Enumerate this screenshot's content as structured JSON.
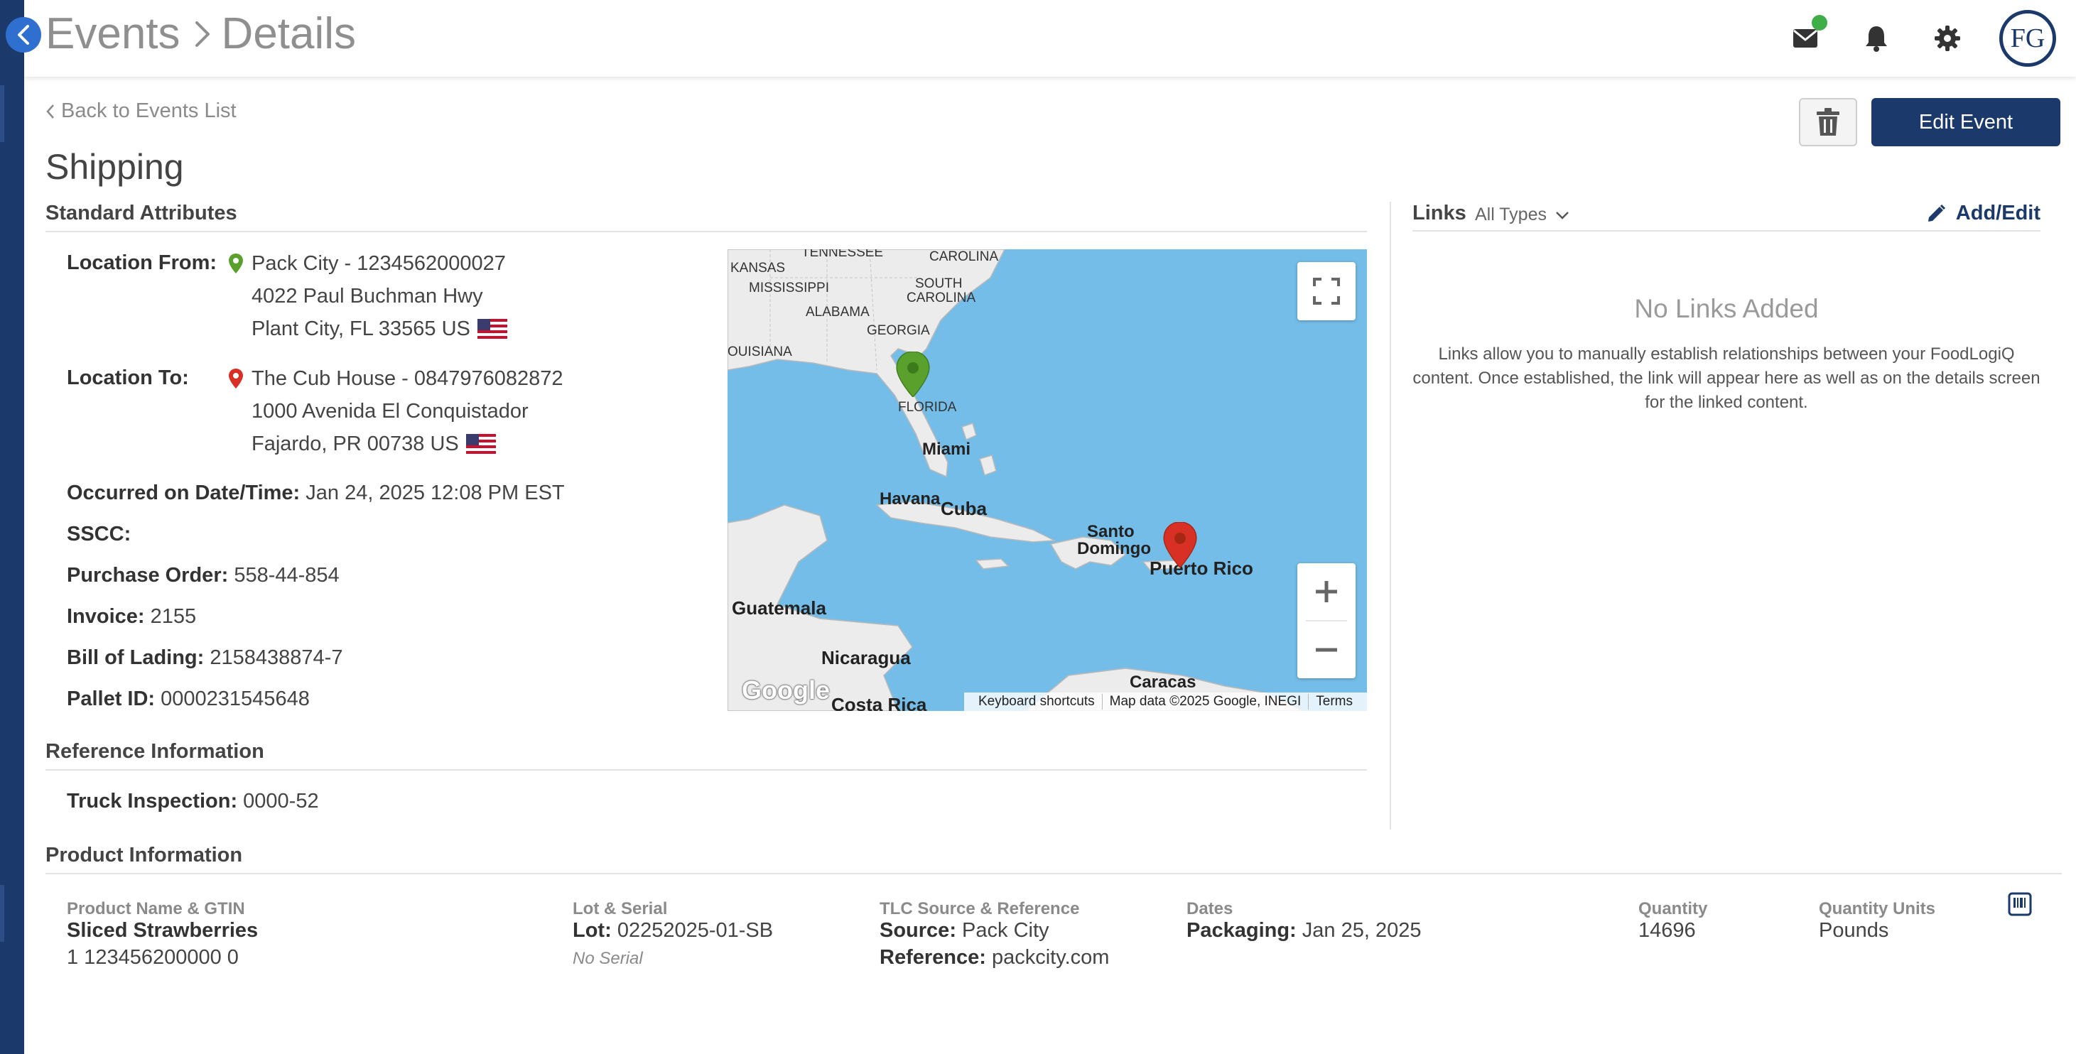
{
  "header": {
    "breadcrumb": [
      "Events",
      "Details"
    ],
    "avatar_text": "FG"
  },
  "actions": {
    "back_label": "Back to Events List",
    "edit_label": "Edit Event"
  },
  "page": {
    "title": "Shipping"
  },
  "standard_attributes": {
    "heading": "Standard Attributes",
    "location_from": {
      "label": "Location From:",
      "line1": "Pack City - 1234562000027",
      "line2": "4022 Paul Buchman Hwy",
      "line3": "Plant City, FL 33565 US"
    },
    "location_to": {
      "label": "Location To:",
      "line1": "The Cub House - 0847976082872",
      "line2": "1000 Avenida El Conquistador",
      "line3": "Fajardo, PR 00738 US"
    },
    "occurred": {
      "label": "Occurred on Date/Time:",
      "value": "Jan 24, 2025 12:08 PM EST"
    },
    "sscc": {
      "label": "SSCC:",
      "value": ""
    },
    "purchase_order": {
      "label": "Purchase Order:",
      "value": "558-44-854"
    },
    "invoice": {
      "label": "Invoice:",
      "value": "2155"
    },
    "bill_of_lading": {
      "label": "Bill of Lading:",
      "value": "2158438874-7"
    },
    "pallet_id": {
      "label": "Pallet ID:",
      "value": "0000231545648"
    }
  },
  "map": {
    "labels": {
      "tennessee": "TENNESSEE",
      "carolina": "CAROLINA",
      "kansas": "KANSAS",
      "mississippi": "MISSISSIPPI",
      "south_carolina_1": "SOUTH",
      "south_carolina_2": "CAROLINA",
      "alabama": "ALABAMA",
      "georgia": "GEORGIA",
      "louisiana": "OUISIANA",
      "florida": "FLORIDA",
      "miami": "Miami",
      "havana": "Havana",
      "cuba": "Cuba",
      "santo_domingo_1": "Santo",
      "santo_domingo_2": "Domingo",
      "puerto_rico": "Puerto Rico",
      "guatemala": "Guatemala",
      "nicaragua": "Nicaragua",
      "caracas": "Caracas",
      "costa_rica": "Costa Rica"
    },
    "google_logo": "Google",
    "footer": {
      "shortcuts": "Keyboard shortcuts",
      "data": "Map data ©2025 Google, INEGI",
      "terms": "Terms"
    },
    "colors": {
      "water": "#74bde8",
      "land": "#ececec",
      "from_pin": "#5aa02c",
      "to_pin": "#d93025"
    }
  },
  "reference_information": {
    "heading": "Reference Information",
    "truck_inspection": {
      "label": "Truck Inspection:",
      "value": "0000-52"
    }
  },
  "links": {
    "title": "Links",
    "type_filter": "All Types",
    "add_edit_label": "Add/Edit",
    "empty_title": "No Links Added",
    "empty_description": "Links allow you to manually establish relationships between your FoodLogiQ content. Once established, the link will appear here as well as on the details screen for the linked content."
  },
  "product_information": {
    "heading": "Product Information",
    "columns": {
      "name": "Product Name & GTIN",
      "lot": "Lot & Serial",
      "tlc": "TLC Source & Reference",
      "dates": "Dates",
      "quantity": "Quantity",
      "units": "Quantity Units"
    },
    "row": {
      "product_name": "Sliced Strawberries",
      "gtin": "1 123456200000 0",
      "lot_label": "Lot:",
      "lot_value": "02252025-01-SB",
      "serial": "No Serial",
      "source_label": "Source:",
      "source_value": "Pack City",
      "reference_label": "Reference:",
      "reference_value": "packcity.com",
      "packaging_label": "Packaging:",
      "packaging_value": "Jan 25, 2025",
      "quantity": "14696",
      "units": "Pounds"
    }
  },
  "colors": {
    "brand": "#1b3a6b",
    "accent_blue": "#2f6fd0",
    "status_green": "#3fae49"
  }
}
